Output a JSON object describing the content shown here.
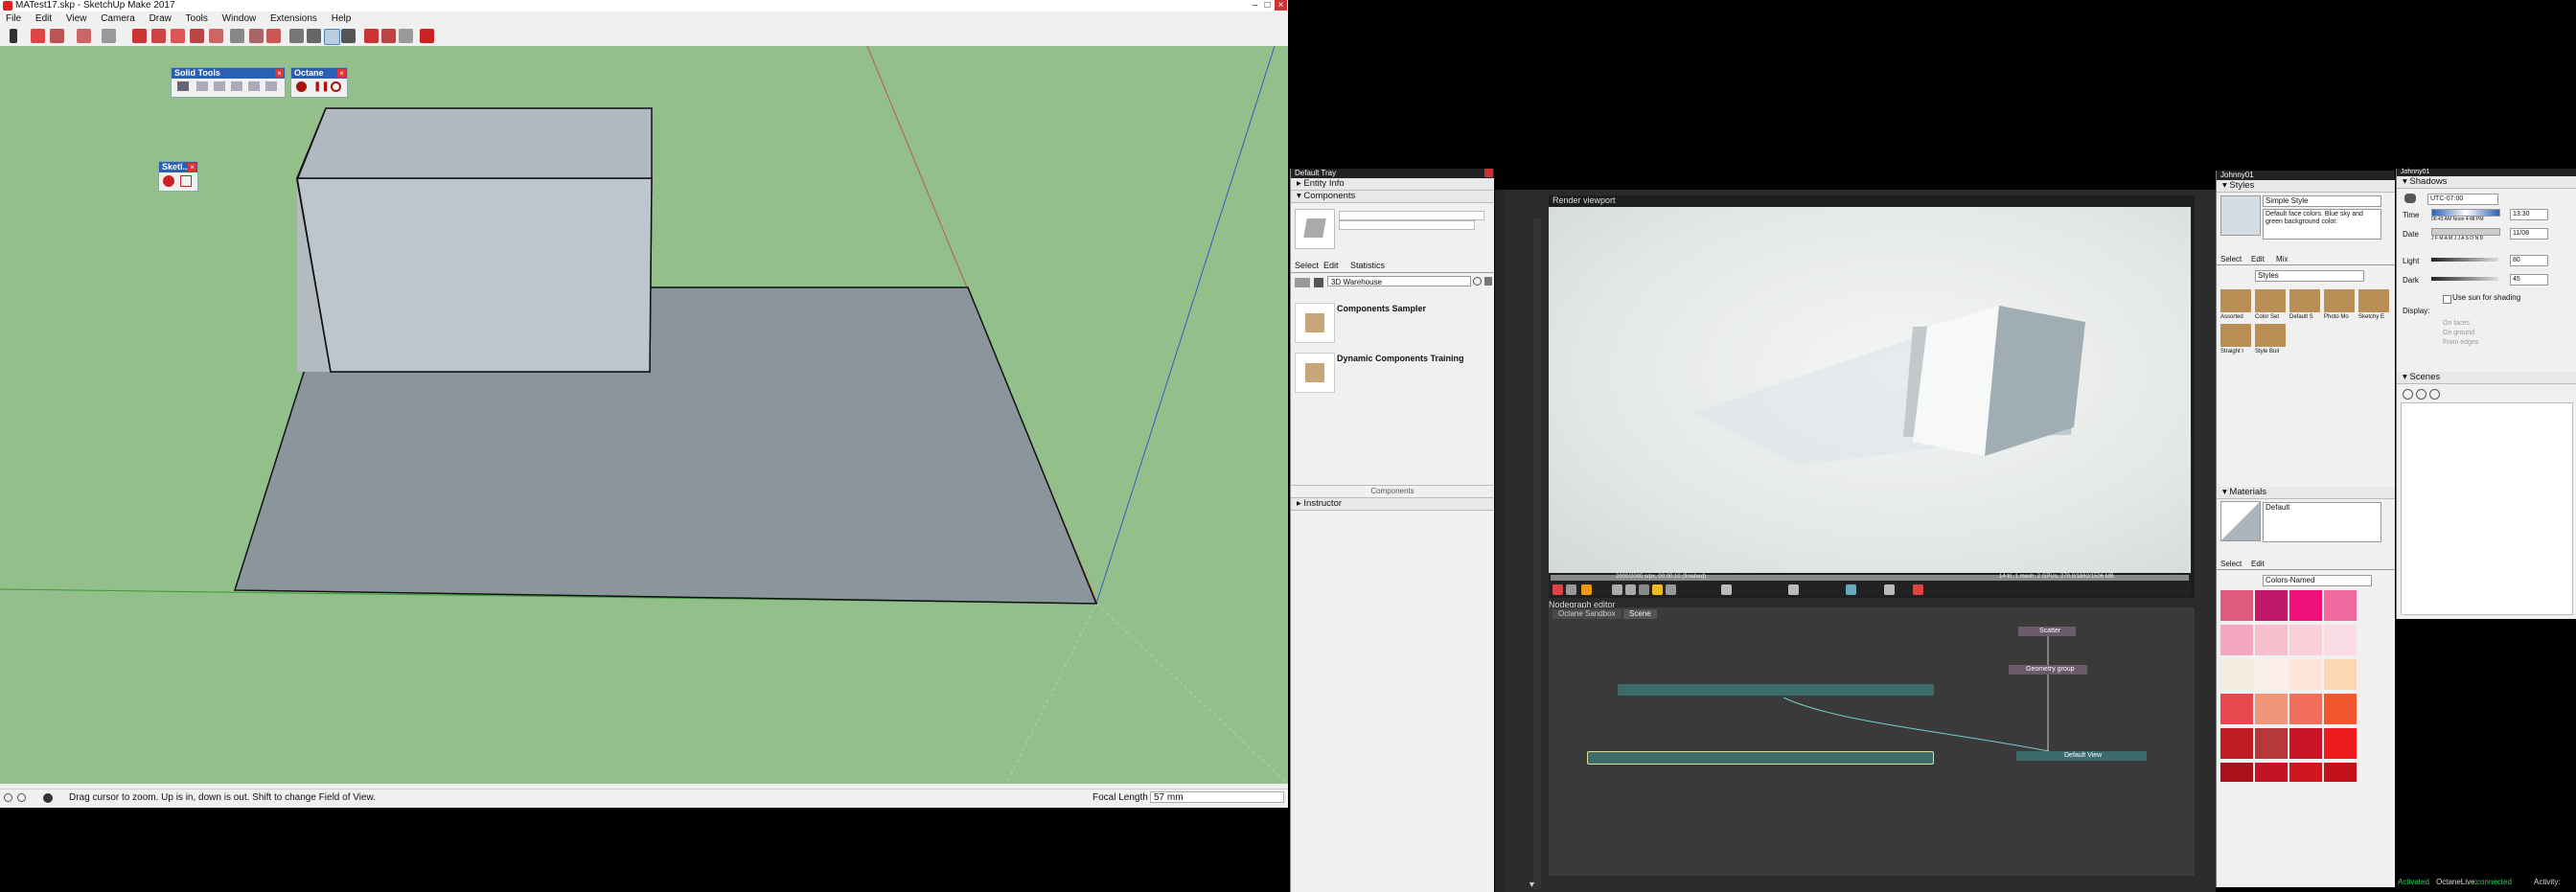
{
  "sketchup": {
    "title": "MATest17.skp - SketchUp Make 2017",
    "menu": [
      "File",
      "Edit",
      "View",
      "Camera",
      "Draw",
      "Tools",
      "Window",
      "Extensions",
      "Help"
    ],
    "solid_tools_title": "Solid Tools",
    "octane_toolbar_title": "Octane",
    "sketch_toolbar_title": "Sketl...",
    "status_text": "Drag cursor to zoom.  Up is in, down is out.  Shift to change Field of View.",
    "focal_label": "Focal Length",
    "focal_value": "57 mm"
  },
  "tray": {
    "title": "Default Tray",
    "sections": {
      "entity_info": "Entity Info",
      "components": "Components",
      "instructor": "Instructor"
    },
    "tabs": [
      "Select",
      "Edit",
      "Statistics"
    ],
    "search_value": "3D Warehouse",
    "items": [
      "Components Sampler",
      "Dynamic Components Training"
    ],
    "footer": "Components"
  },
  "octane": {
    "viewport_title": "Render viewport",
    "progress_left": "2000/2000 s/px, 00:00:10 (finished)",
    "progress_right": "14 tri, 1 mesh, 2 GPUs, 270.0/1862/1506 MB",
    "nodegraph_title": "Nodegraph editor",
    "tabs": [
      "Octane Sandbox",
      "Scene"
    ],
    "nodes": {
      "scatter": "Scatter",
      "geometry_group": "Geometry group",
      "default_view": "Default View"
    }
  },
  "styles_panel": {
    "title": "Johnny01",
    "styles_section": "Styles",
    "style_name": "Simple Style",
    "style_desc": "Default face colors. Blue sky and green background color.",
    "tabs": [
      "Select",
      "Edit",
      "Mix"
    ],
    "style_dropdown": "Styles",
    "style_thumbs": [
      "Assorted",
      "Color Set",
      "Default S",
      "Photo Mo",
      "Sketchy E",
      "Straight l",
      "Style Buil"
    ],
    "materials_section": "Materials",
    "material_name": "Default",
    "mat_tabs": [
      "Select",
      "Edit"
    ],
    "mat_dropdown": "Colors-Named",
    "swatch_colors": [
      "#e05a7f",
      "#c0196c",
      "#f0107a",
      "#f06aa0",
      "#f5a7bf",
      "#f7bfcd",
      "#f9cfd9",
      "#f9dbe3",
      "#f6ebe0",
      "#fcefe9",
      "#fde4d6",
      "#fbd8b5",
      "#e8474f",
      "#f0967a",
      "#f16f5a",
      "#f2562d",
      "#c11b24",
      "#b5383a",
      "#c9152a",
      "#ee1b1e",
      "#a8101a",
      "#c41325",
      "#d2161f",
      "#c3101a"
    ]
  },
  "shadows": {
    "window_title": "Johnny01",
    "section": "Shadows",
    "utc": "UTC-07:00",
    "time_label": "Time",
    "time_value": "13:30",
    "time_ticks": "06:43 AM  Noon  4:48 PM",
    "date_label": "Date",
    "date_value": "11/08",
    "months": "J F M A M J J A S O N D",
    "light_label": "Light",
    "light_value": "80",
    "dark_label": "Dark",
    "dark_value": "45",
    "use_sun": "Use sun for shading",
    "display_label": "Display:",
    "on_faces": "On faces",
    "on_ground": "On ground",
    "from_edges": "From edges",
    "scenes_section": "Scenes"
  },
  "taskbar": {
    "activated": "Activated",
    "octane_live": "OctaneLive:",
    "connected": "connected",
    "activity": "Activity:"
  }
}
